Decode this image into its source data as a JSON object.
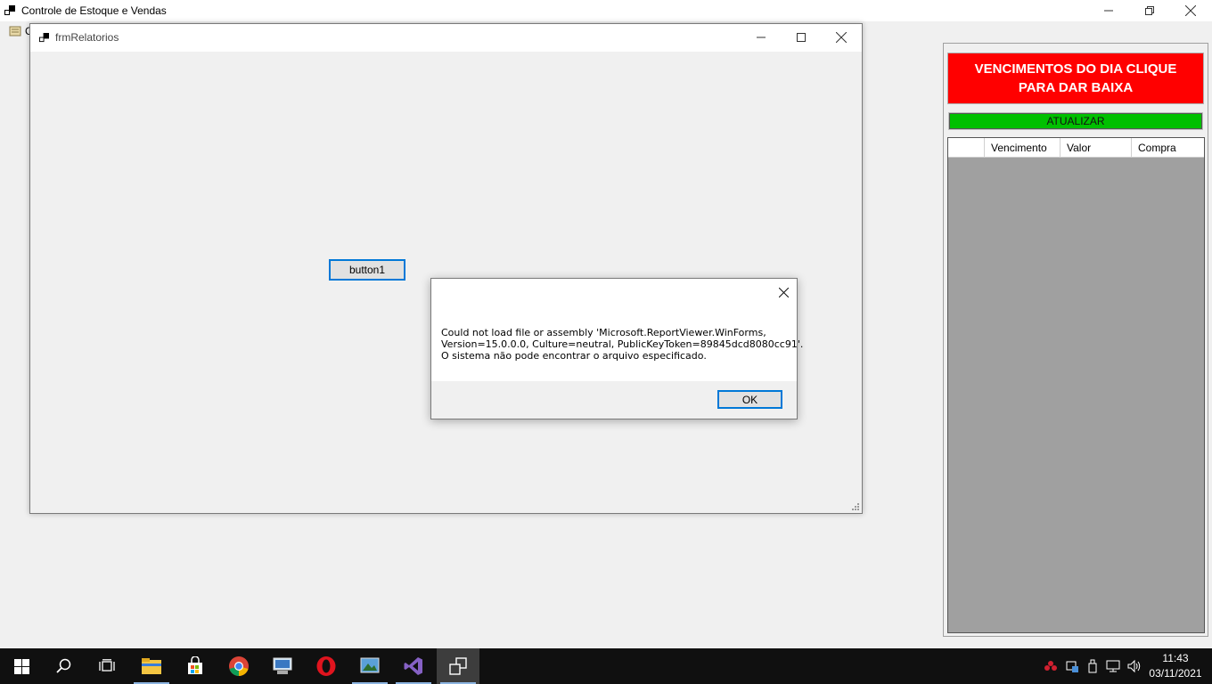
{
  "main_window": {
    "title": "Controle de Estoque e Vendas",
    "menu_text": "C"
  },
  "child_window": {
    "title": "frmRelatorios",
    "button_label": "button1"
  },
  "message_box": {
    "lines": [
      "Could not load file or assembly 'Microsoft.ReportViewer.WinForms,",
      "Version=15.0.0.0, Culture=neutral, PublicKeyToken=89845dcd8080cc91'.",
      "O sistema não pode encontrar o arquivo especificado."
    ],
    "ok_label": "OK"
  },
  "right_panel": {
    "alert_button": "VENCIMENTOS DO DIA CLIQUE PARA DAR BAIXA",
    "refresh_button": "ATUALIZAR",
    "grid_columns": [
      "",
      "Vencimento",
      "Valor",
      "Compra"
    ]
  },
  "taskbar": {
    "time": "11:43",
    "date": "03/11/2021"
  },
  "colors": {
    "alert_red": "#ff0000",
    "refresh_green": "#00c000",
    "accent_blue": "#0078d7",
    "taskbar_bg": "#101010"
  }
}
